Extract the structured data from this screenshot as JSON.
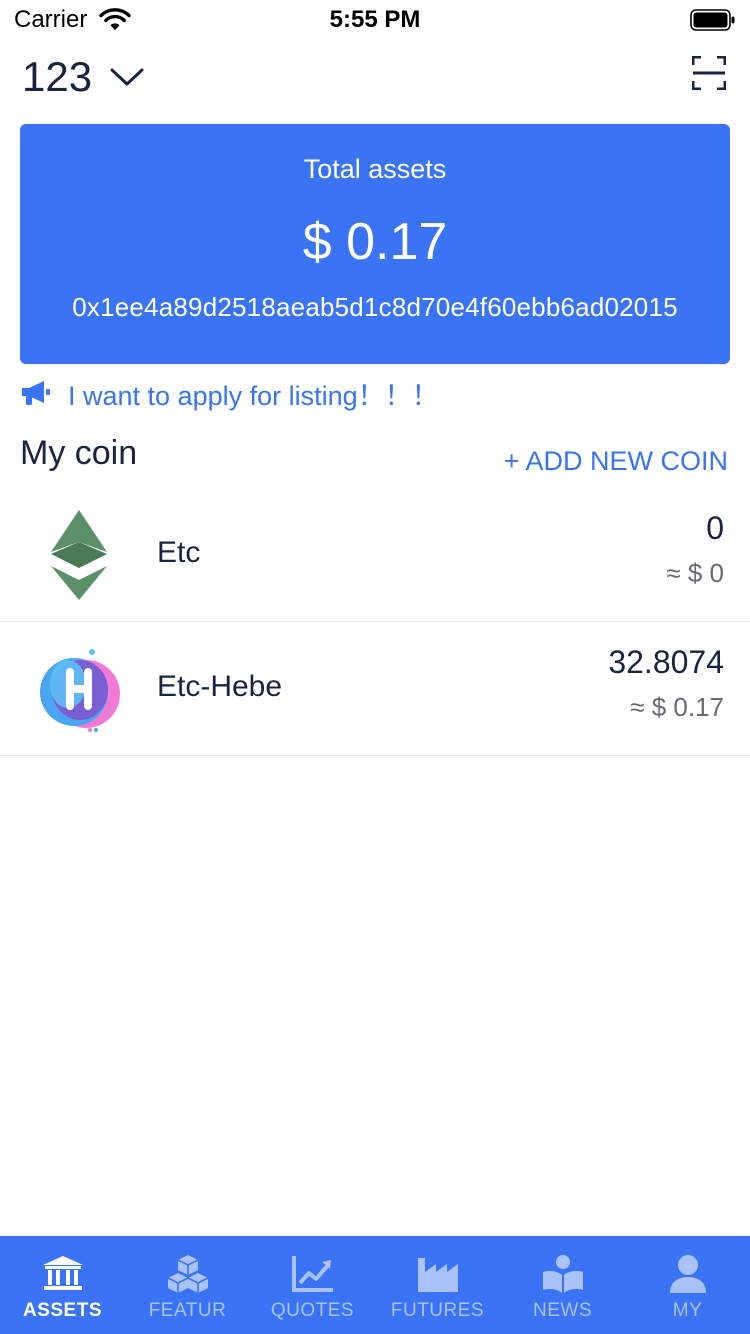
{
  "status_bar": {
    "carrier": "Carrier",
    "time": "5:55 PM"
  },
  "header": {
    "wallet_name": "123",
    "icons": [
      "chevron-down-icon",
      "scan-icon"
    ]
  },
  "assets_card": {
    "label": "Total assets",
    "total": "$ 0.17",
    "address": "0x1ee4a89d2518aeab5d1c8d70e4f60ebb6ad02015",
    "color": "#3a74f5"
  },
  "notice": {
    "text": "I want to apply for listing！！！",
    "icon": "megaphone-icon"
  },
  "coins_section": {
    "title": "My coin",
    "add_label": "+ ADD NEW COIN"
  },
  "coins": [
    {
      "name": "Etc",
      "amount": "0",
      "value": "≈ $ 0",
      "icon": "etc-logo-icon"
    },
    {
      "name": "Etc-Hebe",
      "amount": "32.8074",
      "value": "≈ $ 0.17",
      "icon": "hebe-logo-icon"
    }
  ],
  "tabs": [
    {
      "label": "ASSETS",
      "icon": "bank-icon",
      "active": true
    },
    {
      "label": "FEATUR",
      "icon": "cubes-icon",
      "active": false
    },
    {
      "label": "QUOTES",
      "icon": "chart-icon",
      "active": false
    },
    {
      "label": "FUTURES",
      "icon": "factory-icon",
      "active": false
    },
    {
      "label": "NEWS",
      "icon": "reader-icon",
      "active": false
    },
    {
      "label": "MY",
      "icon": "user-icon",
      "active": false
    }
  ],
  "colors": {
    "accent": "#3a74f5",
    "tab_inactive": "#a9c3fa",
    "text_dark": "#1a2340",
    "text_muted": "#666a73"
  }
}
